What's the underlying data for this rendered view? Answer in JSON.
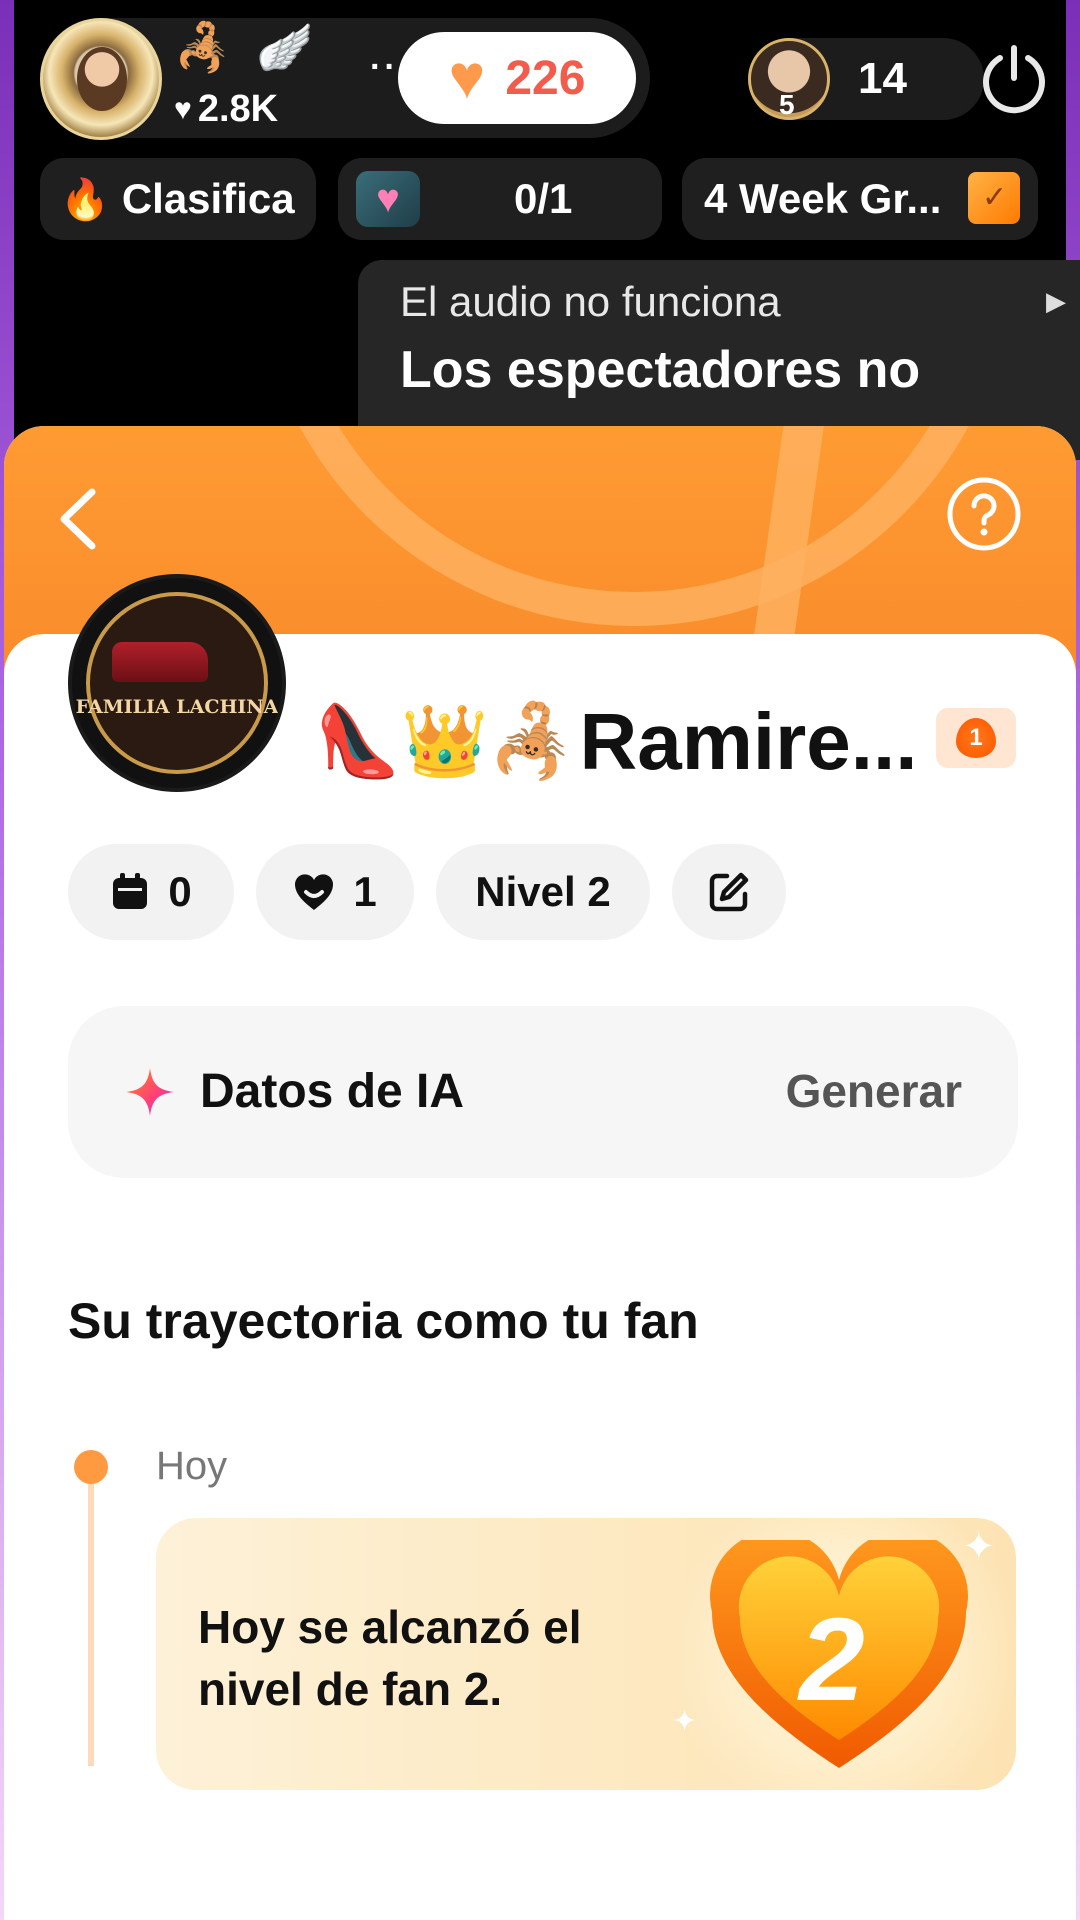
{
  "topbar": {
    "host_likes": "2.8K",
    "dots": "···",
    "like_count": "226",
    "viewer_rank": "5",
    "viewer_count": "14"
  },
  "row2": {
    "ranking_label": "Clasifica",
    "goal_progress": "0/1",
    "week_label": "4 Week Gr..."
  },
  "notice": {
    "subtitle": "El audio no funciona",
    "title": "Los espectadores no"
  },
  "profile": {
    "avatar_text": "FAMILIA LACHINA",
    "name_emojis": "👠👑🦂",
    "name": "Ramire...",
    "badge_level": "1",
    "chips": {
      "days": "0",
      "hearts": "1",
      "level": "Nivel 2"
    }
  },
  "ai": {
    "title": "Datos de IA",
    "action": "Generar"
  },
  "journey": {
    "title": "Su trayectoria como tu fan",
    "date": "Hoy",
    "milestone_text": "Hoy se alcanzó el nivel de fan 2.",
    "milestone_level": "2"
  },
  "colors": {
    "accent": "#ff9b33",
    "heart_orange": "#ff7a1a",
    "like_red": "#f25c4c"
  },
  "icons": {
    "back": "chevron-left-icon",
    "help": "question-circle-icon",
    "power": "power-icon",
    "calendar": "calendar-icon",
    "heart": "heart-icon",
    "edit": "edit-icon",
    "sparkle": "ai-sparkle-icon"
  }
}
